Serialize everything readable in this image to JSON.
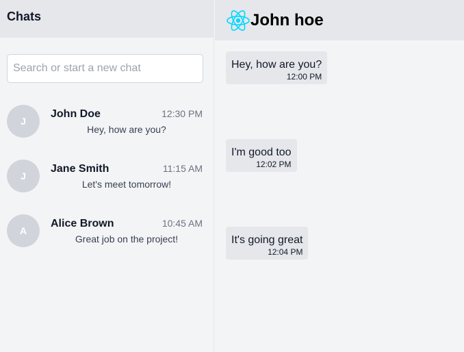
{
  "sidebar": {
    "title": "Chats",
    "search": {
      "placeholder": "Search or start a new chat",
      "value": ""
    },
    "chats": [
      {
        "initial": "J",
        "name": "John Doe",
        "time": "12:30 PM",
        "preview": "Hey, how are you?"
      },
      {
        "initial": "J",
        "name": "Jane Smith",
        "time": "11:15 AM",
        "preview": "Let's meet tomorrow!"
      },
      {
        "initial": "A",
        "name": "Alice Brown",
        "time": "10:45 AM",
        "preview": "Great job on the project!"
      }
    ]
  },
  "conversation": {
    "contact_name": "John hoe",
    "logo_icon": "react-logo-icon",
    "messages": [
      {
        "text": "Hey, how are you?",
        "time": "12:00 PM"
      },
      {
        "text": "I'm good too",
        "time": "12:02 PM"
      },
      {
        "text": "It's going great",
        "time": "12:04 PM"
      }
    ]
  },
  "colors": {
    "header_bg": "#e5e7eb",
    "panel_bg": "#f3f4f6",
    "bubble_bg": "#e5e7eb",
    "avatar_bg": "#d1d5db",
    "react_logo": "#00d8ff"
  }
}
